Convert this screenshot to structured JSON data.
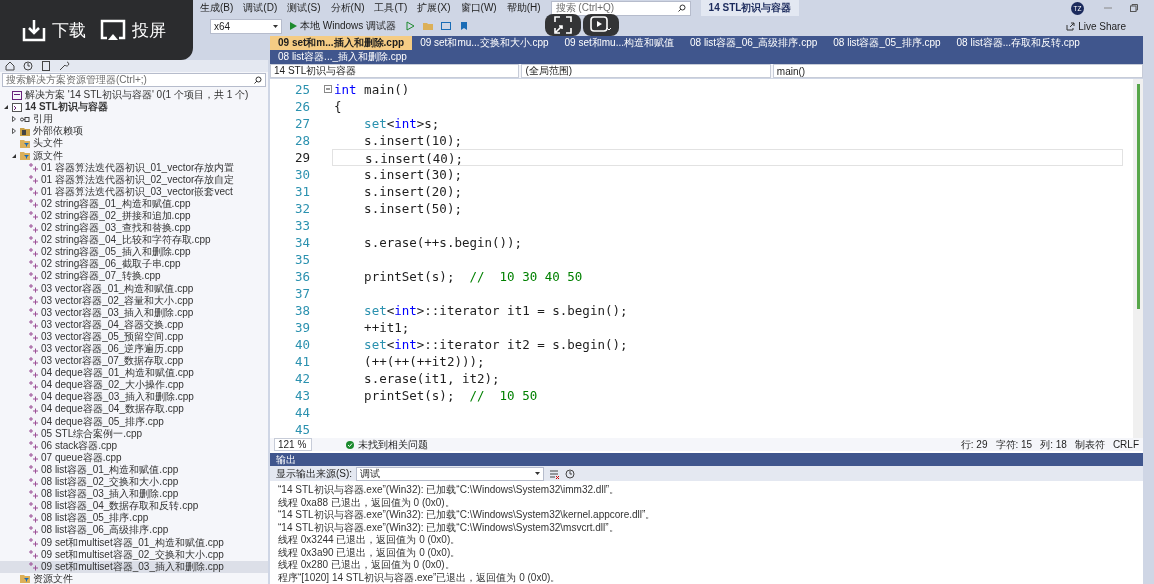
{
  "menu": [
    "生成(B)",
    "调试(D)",
    "测试(S)",
    "分析(N)",
    "工具(T)",
    "扩展(X)",
    "窗口(W)",
    "帮助(H)"
  ],
  "search": {
    "placeholder": "搜索 (Ctrl+Q)"
  },
  "window_title": "14 STL初识与容器",
  "avatar": "TZ",
  "toolbar": {
    "platform": "x64",
    "run": "本地 Windows 调试器",
    "live_share": "Live Share"
  },
  "overlay": {
    "buttons": [
      "下载",
      "投屏"
    ]
  },
  "tabs": [
    {
      "label": "09 set和m...插入和删除.cpp",
      "selected": true
    },
    {
      "label": "09 set和mu...交换和大小.cpp",
      "selected": false
    },
    {
      "label": "09 set和mu...构造和赋值",
      "selected": false
    },
    {
      "label": "08 list容器_06_高级排序.cpp",
      "selected": false
    },
    {
      "label": "08 list容器_05_排序.cpp",
      "selected": false
    },
    {
      "label": "08 list容器...存取和反转.cpp",
      "selected": false
    },
    {
      "label": "08 list容器..._插入和删除.cpp",
      "selected": false
    }
  ],
  "solution_explorer": {
    "search": {
      "placeholder": "搜索解决方案资源管理器(Ctrl+;)"
    },
    "tree": [
      {
        "label": "解决方案 '14 STL初识与容器' 0(1 个项目，共 1 个)",
        "kind": "solution",
        "selected": false
      },
      {
        "label": "14 STL初识与容器",
        "kind": "project",
        "expanded": true,
        "selected": false,
        "children": [
          {
            "label": "引用",
            "kind": "references",
            "expanded": false,
            "selected": false
          },
          {
            "label": "外部依赖项",
            "kind": "dependencies",
            "expanded": false,
            "selected": false
          },
          {
            "label": "头文件",
            "kind": "filter",
            "selected": false
          },
          {
            "label": "源文件",
            "kind": "filter",
            "expanded": true,
            "selected": false,
            "children": [
              {
                "label": "01 容器算法迭代器初识_01_vector存放内置",
                "kind": "file",
                "selected": false
              },
              {
                "label": "01 容器算法迭代器初识_02_vector存放自定",
                "kind": "file",
                "selected": false
              },
              {
                "label": "01 容器算法迭代器初识_03_vector嵌套vect",
                "kind": "file",
                "selected": false
              },
              {
                "label": "02 string容器_01_构造和赋值.cpp",
                "kind": "file",
                "selected": false
              },
              {
                "label": "02 string容器_02_拼接和追加.cpp",
                "kind": "file",
                "selected": false
              },
              {
                "label": "02 string容器_03_查找和替换.cpp",
                "kind": "file",
                "selected": false
              },
              {
                "label": "02 string容器_04_比较和字符存取.cpp",
                "kind": "file",
                "selected": false
              },
              {
                "label": "02 string容器_05_插入和删除.cpp",
                "kind": "file",
                "selected": false
              },
              {
                "label": "02 string容器_06_截取子串.cpp",
                "kind": "file",
                "selected": false
              },
              {
                "label": "02 string容器_07_转换.cpp",
                "kind": "file",
                "selected": false
              },
              {
                "label": "03 vector容器_01_构造和赋值.cpp",
                "kind": "file",
                "selected": false
              },
              {
                "label": "03 vector容器_02_容量和大小.cpp",
                "kind": "file",
                "selected": false
              },
              {
                "label": "03 vector容器_03_插入和删除.cpp",
                "kind": "file",
                "selected": false
              },
              {
                "label": "03 vector容器_04_容器交换.cpp",
                "kind": "file",
                "selected": false
              },
              {
                "label": "03 vector容器_05_预留空间.cpp",
                "kind": "file",
                "selected": false
              },
              {
                "label": "03 vector容器_06_逆序遍历.cpp",
                "kind": "file",
                "selected": false
              },
              {
                "label": "03 vector容器_07_数据存取.cpp",
                "kind": "file",
                "selected": false
              },
              {
                "label": "04 deque容器_01_构造和赋值.cpp",
                "kind": "file",
                "selected": false
              },
              {
                "label": "04 deque容器_02_大小操作.cpp",
                "kind": "file",
                "selected": false
              },
              {
                "label": "04 deque容器_03_插入和删除.cpp",
                "kind": "file",
                "selected": false
              },
              {
                "label": "04 deque容器_04_数据存取.cpp",
                "kind": "file",
                "selected": false
              },
              {
                "label": "04 deque容器_05_排序.cpp",
                "kind": "file",
                "selected": false
              },
              {
                "label": "05 STL综合案例一.cpp",
                "kind": "file",
                "selected": false
              },
              {
                "label": "06 stack容器.cpp",
                "kind": "file",
                "selected": false
              },
              {
                "label": "07 queue容器.cpp",
                "kind": "file",
                "selected": false
              },
              {
                "label": "08 list容器_01_构造和赋值.cpp",
                "kind": "file",
                "selected": false
              },
              {
                "label": "08 list容器_02_交换和大小.cpp",
                "kind": "file",
                "selected": false
              },
              {
                "label": "08 list容器_03_插入和删除.cpp",
                "kind": "file",
                "selected": false
              },
              {
                "label": "08 list容器_04_数据存取和反转.cpp",
                "kind": "file",
                "selected": false
              },
              {
                "label": "08 list容器_05_排序.cpp",
                "kind": "file",
                "selected": false
              },
              {
                "label": "08 list容器_06_高级排序.cpp",
                "kind": "file",
                "selected": false
              },
              {
                "label": "09 set和multiset容器_01_构造和赋值.cpp",
                "kind": "file",
                "selected": false
              },
              {
                "label": "09 set和multiset容器_02_交换和大小.cpp",
                "kind": "file",
                "selected": false
              },
              {
                "label": "09 set和multiset容器_03_插入和删除.cpp",
                "kind": "file",
                "selected": true
              }
            ]
          },
          {
            "label": "资源文件",
            "kind": "filter",
            "selected": false
          }
        ]
      }
    ]
  },
  "editor": {
    "nav": [
      "14 STL初识与容器",
      "(全局范围)",
      "main()"
    ],
    "lines": [
      {
        "number": "25",
        "current": false,
        "tokens": [
          {
            "kind": "keyword",
            "text": "int"
          },
          {
            "kind": "plain",
            "text": " main()"
          }
        ]
      },
      {
        "number": "26",
        "current": false,
        "tokens": [
          {
            "kind": "plain",
            "text": "{"
          }
        ]
      },
      {
        "number": "27",
        "current": false,
        "tokens": [
          {
            "kind": "type",
            "text": "    set"
          },
          {
            "kind": "plain",
            "text": "<"
          },
          {
            "kind": "keyword",
            "text": "int"
          },
          {
            "kind": "plain",
            "text": ">s;"
          }
        ]
      },
      {
        "number": "28",
        "current": false,
        "tokens": [
          {
            "kind": "plain",
            "text": "    s.insert(10);"
          }
        ]
      },
      {
        "number": "29",
        "current": true,
        "tokens": [
          {
            "kind": "plain",
            "text": "    s.insert(40);"
          }
        ]
      },
      {
        "number": "30",
        "current": false,
        "tokens": [
          {
            "kind": "plain",
            "text": "    s.insert(30);"
          }
        ]
      },
      {
        "number": "31",
        "current": false,
        "tokens": [
          {
            "kind": "plain",
            "text": "    s.insert(20);"
          }
        ]
      },
      {
        "number": "32",
        "current": false,
        "tokens": [
          {
            "kind": "plain",
            "text": "    s.insert(50);"
          }
        ]
      },
      {
        "number": "33",
        "current": false
      },
      {
        "number": "34",
        "current": false,
        "tokens": [
          {
            "kind": "plain",
            "text": "    s.erase(++s.begin());"
          }
        ]
      },
      {
        "number": "35",
        "current": false
      },
      {
        "number": "36",
        "current": false,
        "tokens": [
          {
            "kind": "plain",
            "text": "    printSet(s);  "
          },
          {
            "kind": "comment",
            "text": "//  10 30 40 50"
          }
        ]
      },
      {
        "number": "37",
        "current": false
      },
      {
        "number": "38",
        "current": false,
        "tokens": [
          {
            "kind": "type",
            "text": "    set"
          },
          {
            "kind": "plain",
            "text": "<"
          },
          {
            "kind": "keyword",
            "text": "int"
          },
          {
            "kind": "plain",
            "text": ">::iterator it1 = s.begin();"
          }
        ]
      },
      {
        "number": "39",
        "current": false,
        "tokens": [
          {
            "kind": "plain",
            "text": "    ++it1;"
          }
        ]
      },
      {
        "number": "40",
        "current": false,
        "tokens": [
          {
            "kind": "type",
            "text": "    set"
          },
          {
            "kind": "plain",
            "text": "<"
          },
          {
            "kind": "keyword",
            "text": "int"
          },
          {
            "kind": "plain",
            "text": ">::iterator it2 = s.begin();"
          }
        ]
      },
      {
        "number": "41",
        "current": false,
        "tokens": [
          {
            "kind": "plain",
            "text": "    (++(++(++it2)));"
          }
        ]
      },
      {
        "number": "42",
        "current": false,
        "tokens": [
          {
            "kind": "plain",
            "text": "    s.erase(it1, it2);"
          }
        ]
      },
      {
        "number": "43",
        "current": false,
        "tokens": [
          {
            "kind": "plain",
            "text": "    printSet(s);  "
          },
          {
            "kind": "comment",
            "text": "//  10 50"
          }
        ]
      },
      {
        "number": "44",
        "current": false
      },
      {
        "number": "45",
        "current": false
      }
    ],
    "status": {
      "zoom": "121 %",
      "issues": "未找到相关问题",
      "line": "行: 29",
      "char": "字符: 15",
      "col": "列: 18",
      "indent": "制表符",
      "eol": "CRLF"
    }
  },
  "output": {
    "title": "输出",
    "source_label": "显示输出来源(S):",
    "source": "调试",
    "lines": [
      "“14 STL初识与容器.exe”(Win32): 已加载“C:\\Windows\\System32\\imm32.dll”。",
      "线程 0xa88 已退出，返回值为 0 (0x0)。",
      "“14 STL初识与容器.exe”(Win32): 已加载“C:\\Windows\\System32\\kernel.appcore.dll”。",
      "“14 STL初识与容器.exe”(Win32): 已加载“C:\\Windows\\System32\\msvcrt.dll”。",
      "线程 0x3244 已退出，返回值为 0 (0x0)。",
      "线程 0x3a90 已退出，返回值为 0 (0x0)。",
      "线程 0x280 已退出，返回值为 0 (0x0)。",
      "程序“[1020] 14 STL初识与容器.exe”已退出，返回值为 0 (0x0)。"
    ]
  }
}
